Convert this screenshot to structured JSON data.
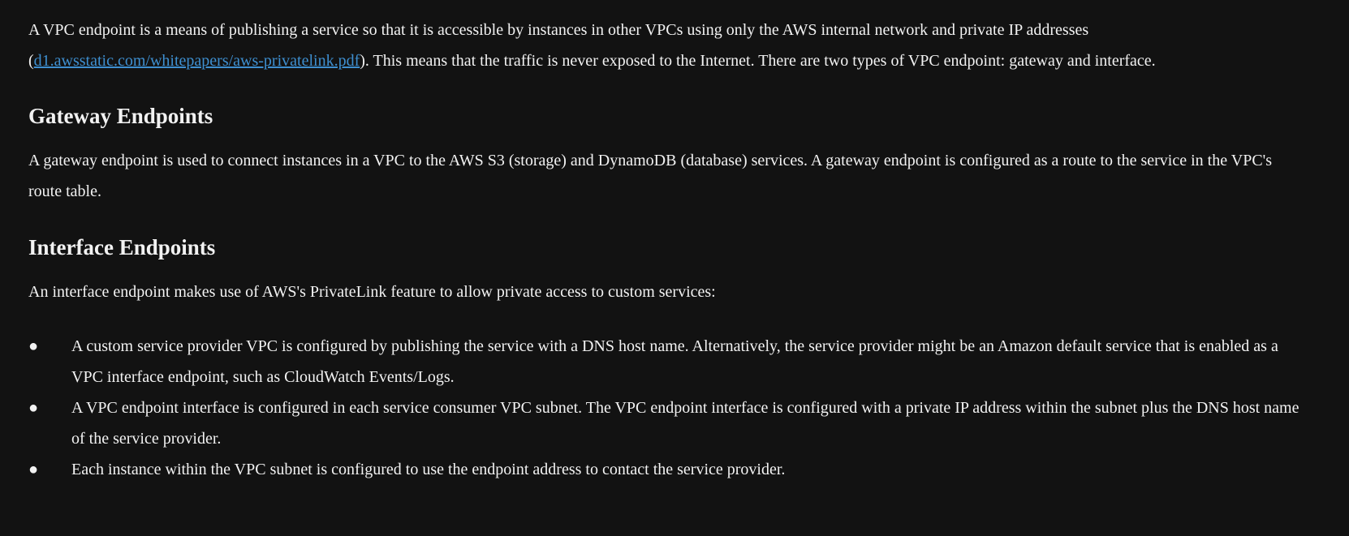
{
  "intro": {
    "text_before_link": "A VPC endpoint is a means of publishing a service so that it is accessible by instances in other VPCs using only the AWS internal network and private IP addresses (",
    "link_text": "d1.awsstatic.com/whitepapers/aws-privatelink.pdf",
    "text_after_link": "). This means that the traffic is never exposed to the Internet. There are two types of VPC endpoint: gateway and interface."
  },
  "gateway": {
    "heading": "Gateway Endpoints",
    "paragraph": "A gateway endpoint is used to connect instances in a VPC to the AWS S3 (storage) and DynamoDB (database) services. A gateway endpoint is configured as a route to the service in the VPC's route table."
  },
  "interface": {
    "heading": "Interface Endpoints",
    "paragraph": "An interface endpoint makes use of AWS's PrivateLink feature to allow private access to custom services:",
    "bullet_glyph": "●",
    "bullets": [
      "A custom service provider VPC is configured by publishing the service with a DNS host name. Alternatively, the service provider might be an Amazon default service that is enabled as a VPC interface endpoint, such as CloudWatch Events/Logs.",
      "A VPC endpoint interface is configured in each service consumer VPC subnet. The VPC endpoint interface is configured with a private IP address within the subnet plus the DNS host name of the service provider.",
      "Each instance within the VPC subnet is configured to use the endpoint address to contact the service provider."
    ]
  },
  "colors": {
    "background": "#121212",
    "text": "#f2f2f2",
    "link": "#3e8fd0"
  }
}
